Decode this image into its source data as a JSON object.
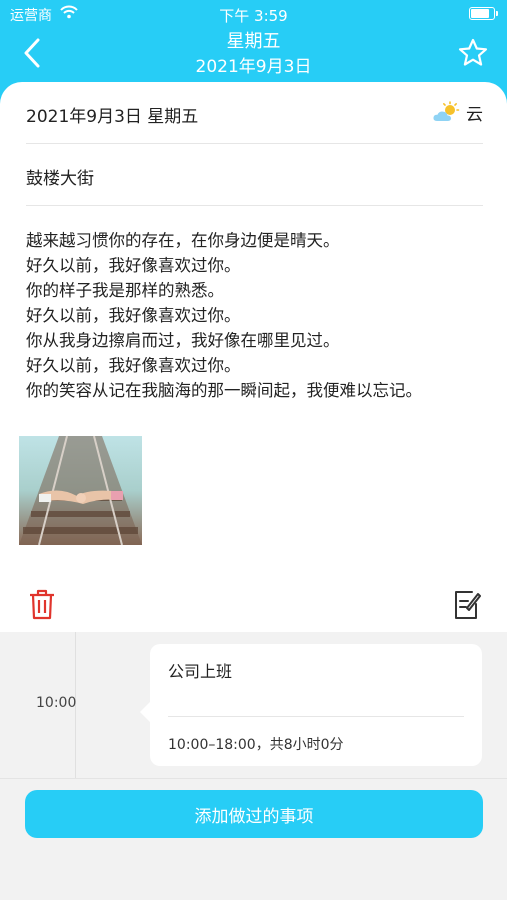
{
  "status_bar": {
    "carrier": "运营商",
    "time": "下午 3:59",
    "battery_level": 0.9
  },
  "nav": {
    "title": "星期五",
    "subtitle": "2021年9月3日",
    "back_icon": "chevron-left-icon",
    "favorite_icon": "star-outline-icon"
  },
  "diary": {
    "date_line": "2021年9月3日  星期五",
    "weather": {
      "icon": "partly-cloudy-icon",
      "label": "云"
    },
    "location": "鼓楼大街",
    "content": "越来越习惯你的存在，在你身边便是晴天。\n好久以前，我好像喜欢过你。\n你的样子我是那样的熟悉。\n好久以前，我好像喜欢过你。\n你从我身边擦肩而过，我好像在哪里见过。\n好久以前，我好像喜欢过你。\n你的笑容从记在我脑海的那一瞬间起，我便难以忘记。",
    "actions": {
      "delete_icon": "trash-icon",
      "edit_icon": "edit-note-icon"
    }
  },
  "timeline": {
    "events": [
      {
        "time": "10:00",
        "title": "公司上班",
        "detail": "10:00–18:00，共8小时0分"
      }
    ]
  },
  "add_button_label": "添加做过的事项",
  "colors": {
    "accent": "#27cdf6",
    "delete": "#e0342c",
    "background": "#f2f2f2"
  }
}
